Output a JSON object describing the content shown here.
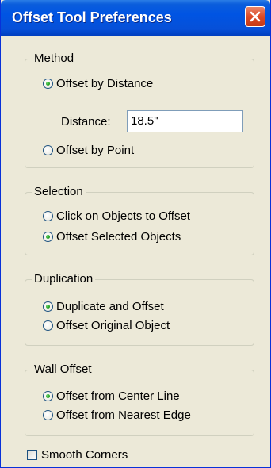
{
  "window": {
    "title": "Offset Tool Preferences"
  },
  "method": {
    "label": "Method",
    "offset_by_distance": {
      "label": "Offset by Distance",
      "selected": true
    },
    "distance": {
      "label": "Distance:",
      "value": "18.5\""
    },
    "offset_by_point": {
      "label": "Offset by Point",
      "selected": false
    }
  },
  "selection": {
    "label": "Selection",
    "click_on_objects": {
      "label": "Click on Objects to Offset",
      "selected": false
    },
    "offset_selected": {
      "label": "Offset Selected Objects",
      "selected": true
    }
  },
  "duplication": {
    "label": "Duplication",
    "duplicate_and_offset": {
      "label": "Duplicate and Offset",
      "selected": true
    },
    "offset_original": {
      "label": "Offset Original Object",
      "selected": false
    }
  },
  "wall_offset": {
    "label": "Wall Offset",
    "from_center_line": {
      "label": "Offset from Center Line",
      "selected": true
    },
    "from_nearest_edge": {
      "label": "Offset from Nearest Edge",
      "selected": false
    }
  },
  "smooth_corners": {
    "label": "Smooth Corners",
    "checked": false
  },
  "colors": {
    "titlebar": "#0054e3",
    "close_button": "#dd4a26",
    "dialog_background": "#ece9d8",
    "radio_dot": "#21a121"
  }
}
